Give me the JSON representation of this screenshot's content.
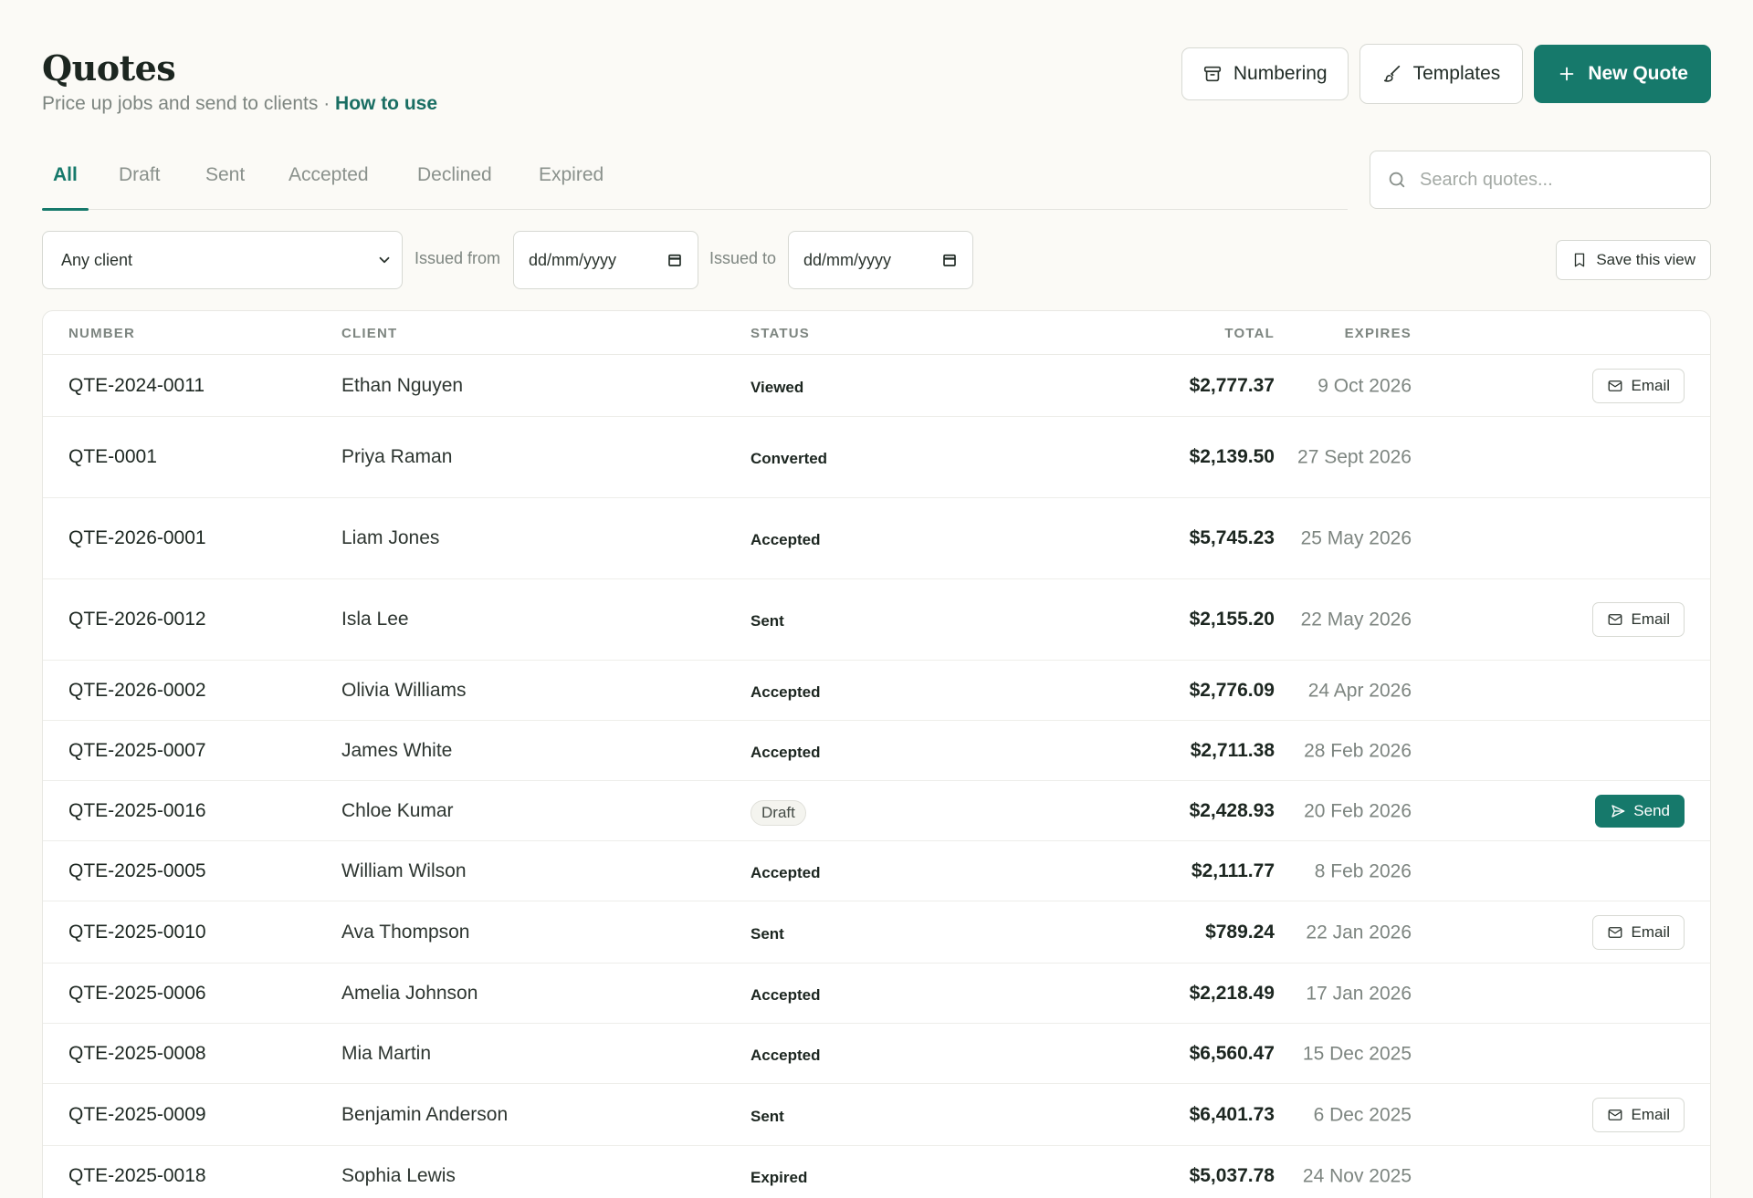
{
  "header": {
    "title": "Quotes",
    "subtitle": "Price up jobs and send to clients",
    "separator": " · ",
    "help_link": "How to use",
    "numbering_label": "Numbering",
    "templates_label": "Templates",
    "new_quote_label": "New Quote"
  },
  "tabs": [
    "All",
    "Draft",
    "Sent",
    "Accepted",
    "Declined",
    "Expired"
  ],
  "active_tab": "All",
  "search": {
    "placeholder": "Search quotes..."
  },
  "filters": {
    "client_select": "Any client",
    "issued_from_label": "Issued from",
    "issued_from_value": "dd/mm/yyyy",
    "issued_to_label": "Issued to",
    "issued_to_value": "dd/mm/yyyy",
    "save_view_label": "Save this view"
  },
  "table": {
    "columns": {
      "number": "NUMBER",
      "client": "CLIENT",
      "status": "STATUS",
      "total": "TOTAL",
      "expires": "EXPIRES"
    },
    "rows": [
      {
        "number": "QTE-2024-0011",
        "client": "Ethan Nguyen",
        "status": "Viewed",
        "total": "$2,777.37",
        "expires": "9 Oct 2026",
        "action": "Email"
      },
      {
        "number": "QTE-0001",
        "client": "Priya Raman",
        "status": "Converted",
        "total": "$2,139.50",
        "expires": "27 Sept 2026",
        "action": ""
      },
      {
        "number": "QTE-2026-0001",
        "client": "Liam Jones",
        "status": "Accepted",
        "total": "$5,745.23",
        "expires": "25 May 2026",
        "action": ""
      },
      {
        "number": "QTE-2026-0012",
        "client": "Isla Lee",
        "status": "Sent",
        "total": "$2,155.20",
        "expires": "22 May 2026",
        "action": "Email"
      },
      {
        "number": "QTE-2026-0002",
        "client": "Olivia Williams",
        "status": "Accepted",
        "total": "$2,776.09",
        "expires": "24 Apr 2026",
        "action": ""
      },
      {
        "number": "QTE-2025-0007",
        "client": "James White",
        "status": "Accepted",
        "total": "$2,711.38",
        "expires": "28 Feb 2026",
        "action": ""
      },
      {
        "number": "QTE-2025-0016",
        "client": "Chloe Kumar",
        "status": "Draft",
        "total": "$2,428.93",
        "expires": "20 Feb 2026",
        "action": "Send"
      },
      {
        "number": "QTE-2025-0005",
        "client": "William Wilson",
        "status": "Accepted",
        "total": "$2,111.77",
        "expires": "8 Feb 2026",
        "action": ""
      },
      {
        "number": "QTE-2025-0010",
        "client": "Ava Thompson",
        "status": "Sent",
        "total": "$789.24",
        "expires": "22 Jan 2026",
        "action": "Email"
      },
      {
        "number": "QTE-2025-0006",
        "client": "Amelia Johnson",
        "status": "Accepted",
        "total": "$2,218.49",
        "expires": "17 Jan 2026",
        "action": ""
      },
      {
        "number": "QTE-2025-0008",
        "client": "Mia Martin",
        "status": "Accepted",
        "total": "$6,560.47",
        "expires": "15 Dec 2025",
        "action": ""
      },
      {
        "number": "QTE-2025-0009",
        "client": "Benjamin Anderson",
        "status": "Sent",
        "total": "$6,401.73",
        "expires": "6 Dec 2025",
        "action": "Email"
      },
      {
        "number": "QTE-2025-0018",
        "client": "Sophia Lewis",
        "status": "Expired",
        "total": "$5,037.78",
        "expires": "24 Nov 2025",
        "action": ""
      }
    ]
  },
  "colors": {
    "accent": "#16796b",
    "background": "#fbfaf6",
    "muted": "#7d8580",
    "border": "#d7d9d3"
  },
  "icons": {
    "numbering": "archive-icon",
    "templates": "brush-icon",
    "new_quote": "plus-icon",
    "search": "search-icon",
    "select": "chevron-down-icon",
    "date": "calendar-icon",
    "save_view": "bookmark-icon",
    "email": "mail-icon",
    "send": "send-icon"
  }
}
